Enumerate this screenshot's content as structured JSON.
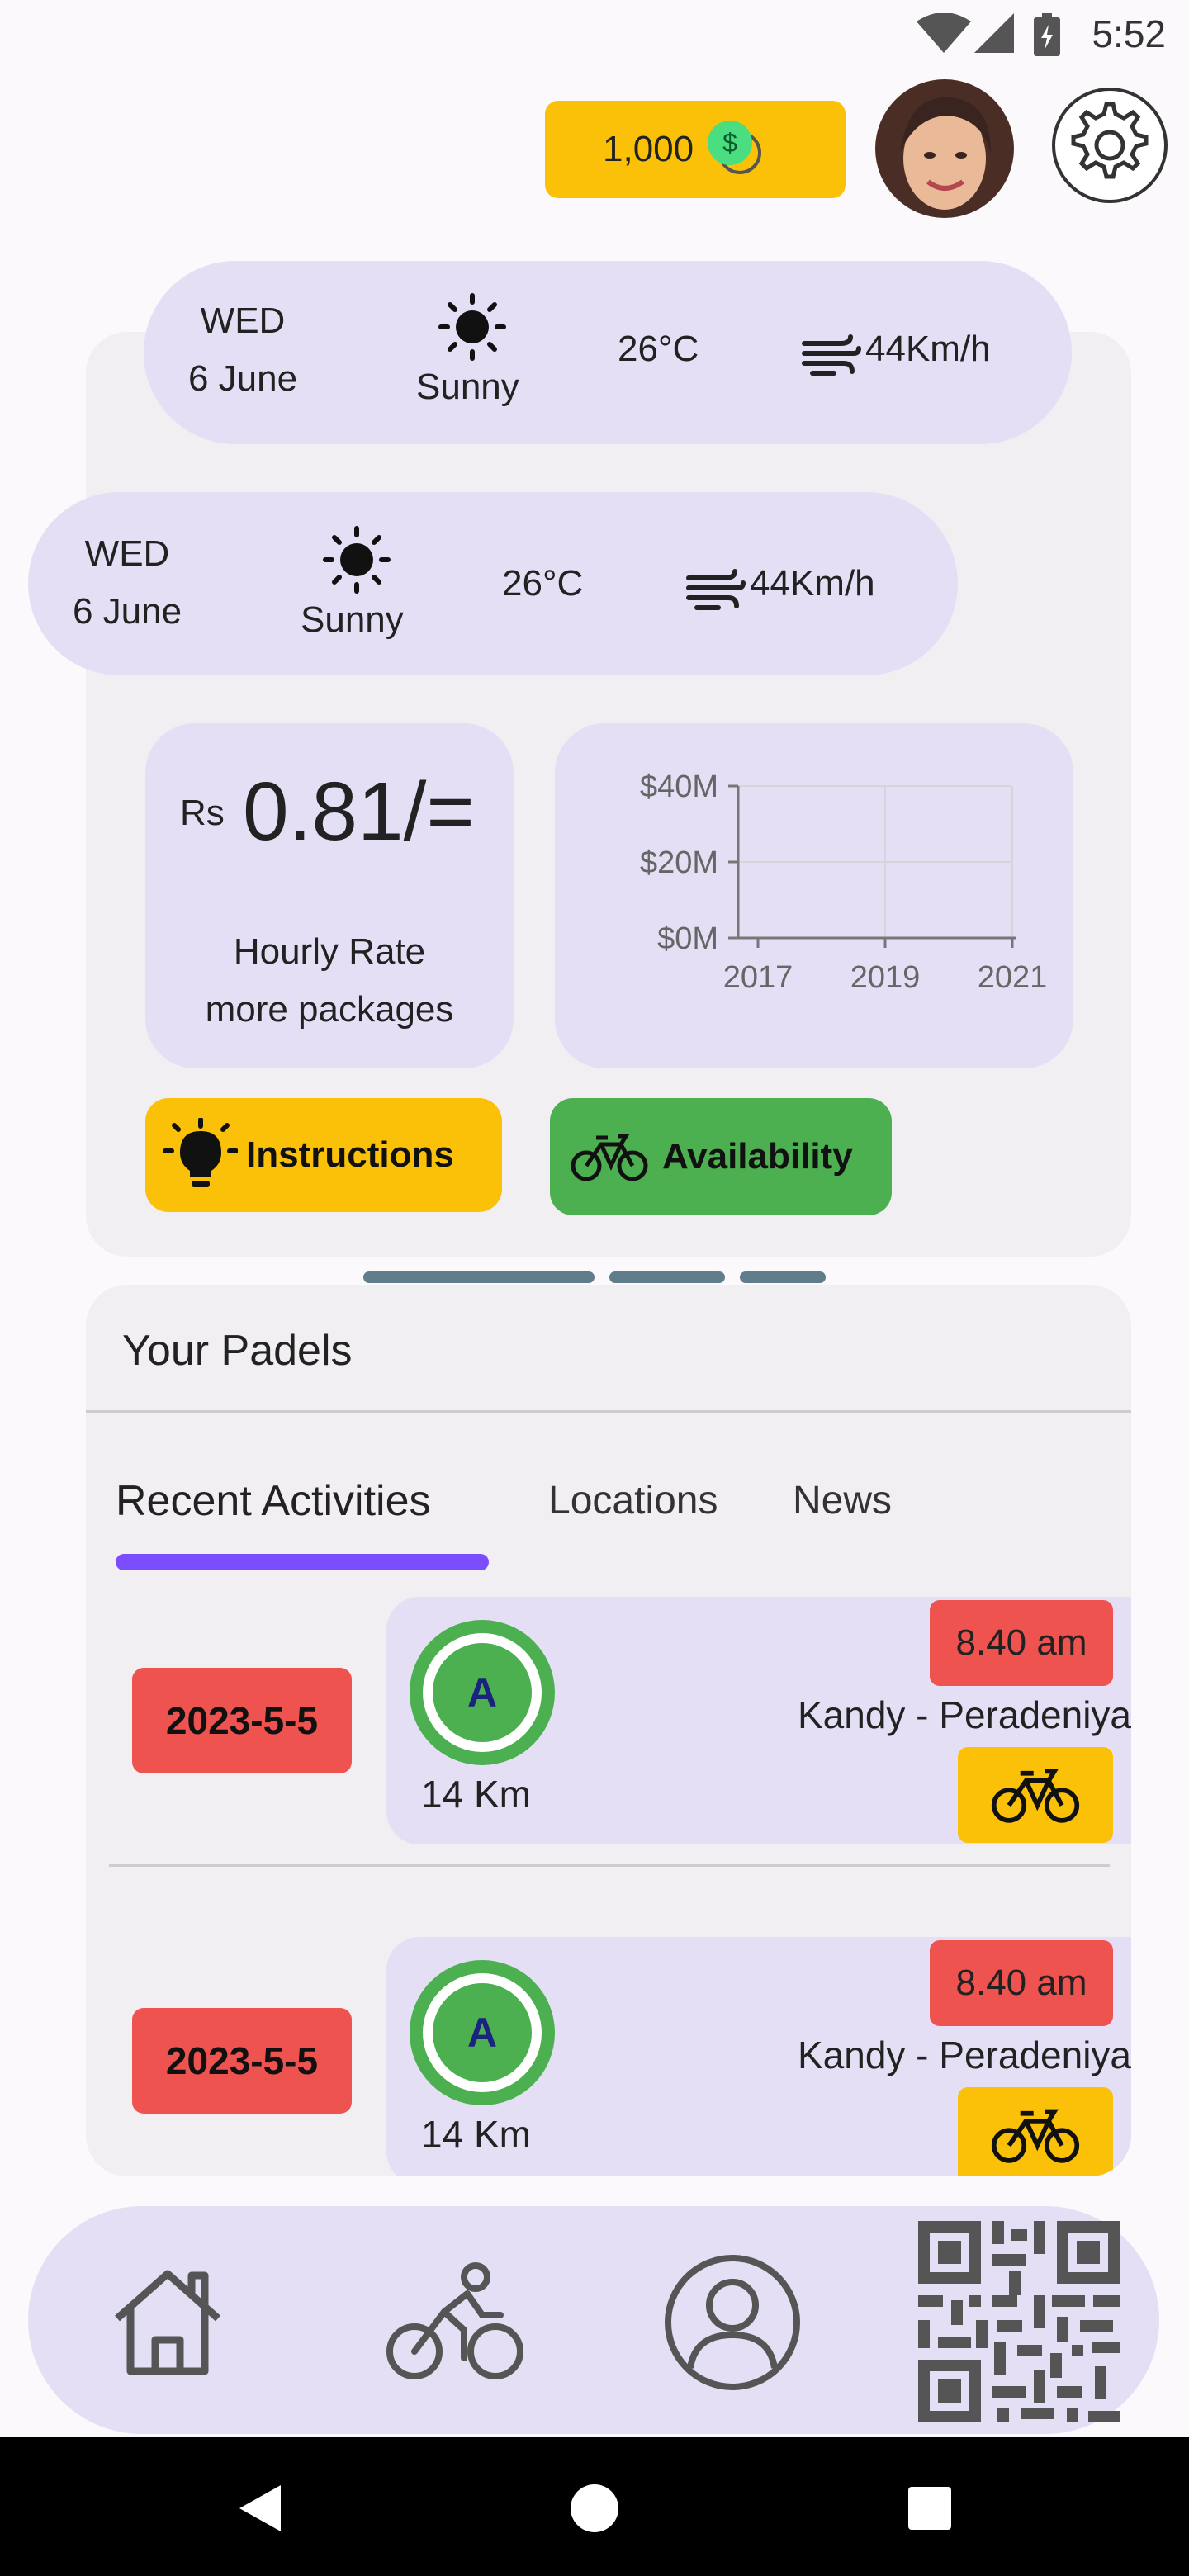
{
  "status_bar": {
    "time": "5:52"
  },
  "header": {
    "coins": "1,000",
    "coin_symbol": "$"
  },
  "weather": [
    {
      "day": "WED",
      "date": "6 June",
      "condition": "Sunny",
      "temp": "26°C",
      "wind": "44Km/h"
    },
    {
      "day": "WED",
      "date": "6 June",
      "condition": "Sunny",
      "temp": "26°C",
      "wind": "44Km/h"
    }
  ],
  "rate": {
    "currency": "Rs",
    "value": "0.81/=",
    "label_line1": "Hourly Rate",
    "label_line2": "more packages"
  },
  "chart_data": {
    "type": "line",
    "x": [
      "2017",
      "2019",
      "2021"
    ],
    "y_ticks": [
      "$40M",
      "$20M",
      "$0M"
    ],
    "ylim": [
      0,
      40
    ],
    "series": [],
    "grid": true
  },
  "buttons": {
    "instructions": "Instructions",
    "availability": "Availability"
  },
  "padels": {
    "title": "Your Padels",
    "tabs": [
      "Recent Activities",
      "Locations",
      "News"
    ],
    "activities": [
      {
        "date": "2023-5-5",
        "badge": "A",
        "distance": "14 Km",
        "time": "8.40 am",
        "route": "Kandy - Peradeniya"
      },
      {
        "date": "2023-5-5",
        "badge": "A",
        "distance": "14 Km",
        "time": "8.40 am",
        "route": "Kandy - Peradeniya"
      }
    ]
  },
  "colors": {
    "accent_yellow": "#fbc108",
    "accent_green": "#4caf50",
    "accent_red": "#ef5350",
    "tab_indicator": "#7c4dff",
    "card_lilac": "#e4dff5"
  },
  "icons": {
    "bottom_nav": [
      "home-icon",
      "cyclist-icon",
      "profile-icon",
      "qr-code-icon"
    ],
    "android_nav": [
      "back-icon",
      "home-circle-icon",
      "recents-icon"
    ]
  }
}
